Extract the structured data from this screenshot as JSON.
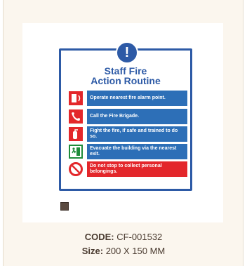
{
  "sign": {
    "title_line1": "Staff Fire",
    "title_line2": "Action Routine",
    "steps": [
      {
        "text": "Operate nearest fire alarm point.",
        "icon": "fire-alarm-icon",
        "color": "#2d6fb7"
      },
      {
        "text": "Call the Fire Brigade.",
        "icon": "phone-icon",
        "color": "#2d6fb7"
      },
      {
        "text": "Fight the fire, if safe and trained to do so.",
        "icon": "fire-extinguisher-icon",
        "color": "#2d6fb7"
      },
      {
        "text": "Evacuate the building via the nearest exit.",
        "icon": "exit-icon",
        "color": "#2d6fb7"
      },
      {
        "text": "Do not stop to collect personal belongings.",
        "icon": "no-entry-icon",
        "color": "#e3272b"
      }
    ]
  },
  "product": {
    "code_label": "CODE:",
    "code_value": "CF-001532",
    "size_label": "Size:",
    "size_value": "200 X 150 MM"
  }
}
